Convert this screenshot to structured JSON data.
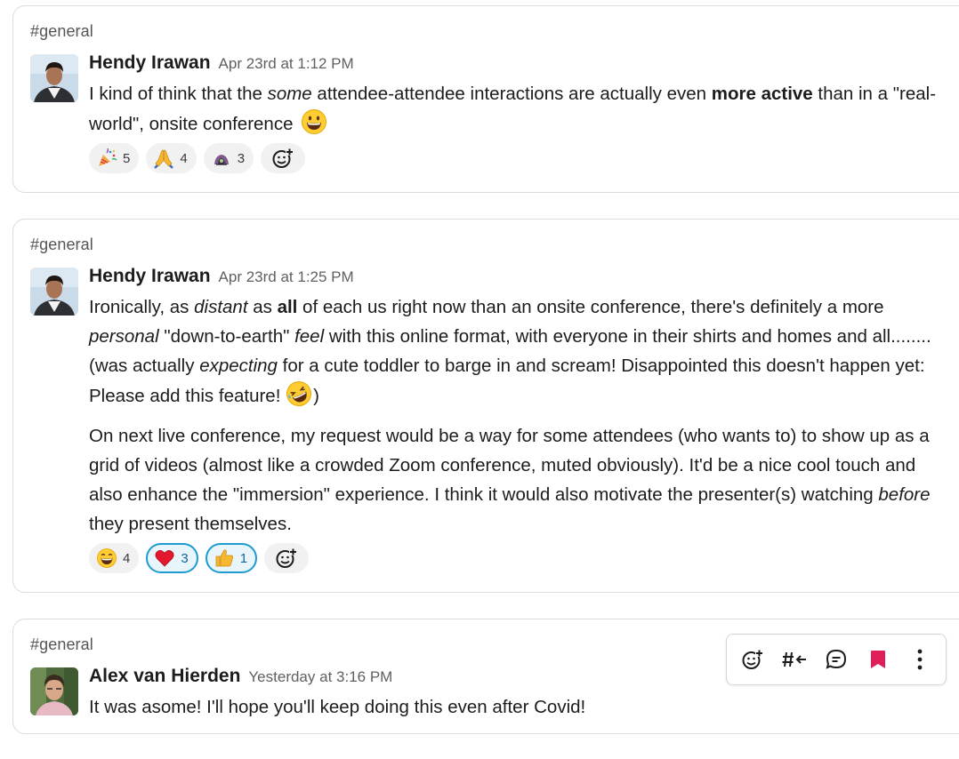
{
  "messages": [
    {
      "channel": "#general",
      "author": "Hendy Irawan",
      "timestamp": "Apr 23rd at 1:12 PM",
      "text": {
        "t1": "I kind of think that the ",
        "t1_em": "some",
        "t2": " attendee-attendee interactions are actually even ",
        "t2_bold": "more active",
        "t3": " than in a \"real-world\", onsite conference"
      },
      "inline_emoji": "grinning-face-icon",
      "reactions": [
        {
          "icon": "party-popper-icon",
          "count": "5",
          "mine": false
        },
        {
          "icon": "folded-hands-icon",
          "count": "4",
          "mine": false
        },
        {
          "icon": "custom-emoji-icon",
          "count": "3",
          "mine": false
        }
      ]
    },
    {
      "channel": "#general",
      "author": "Hendy Irawan",
      "timestamp": "Apr 23rd at 1:25 PM",
      "paragraph1": {
        "a": "Ironically, as ",
        "b_em": "distant",
        "c": " as ",
        "d_bold": "all",
        "e": " of each us right now than an onsite conference, there's definitely a more ",
        "f_em": "personal",
        "g": " \"down-to-earth\" ",
        "h_em": "feel",
        "i": " with this online format, with everyone in their shirts and homes and all........ (was actually ",
        "j_em": "expecting",
        "k": " for a cute toddler to barge in and scream! Disappointed this doesn't happen yet: Please add this feature! ",
        "l": ")"
      },
      "paragraph2": {
        "a": "On next live conference, my request would be a way for some attendees (who wants to) to show up as a grid of videos (almost like a crowded Zoom conference, muted obviously). It'd be a nice cool touch and also enhance the \"immersion\" experience. I think it would also motivate the presenter(s) watching ",
        "b_em": "before",
        "c": " they present themselves."
      },
      "inline_emoji": "rolling-on-floor-laughing-icon",
      "reactions": [
        {
          "icon": "grinning-squinting-face-icon",
          "count": "4",
          "mine": false
        },
        {
          "icon": "red-heart-icon",
          "count": "3",
          "mine": true
        },
        {
          "icon": "thumbs-up-icon",
          "count": "1",
          "mine": true
        }
      ]
    },
    {
      "channel": "#general",
      "author": "Alex van Hierden",
      "timestamp": "Yesterday at 3:16 PM",
      "text": "It was asome! I'll hope you'll keep doing this even after Covid!"
    }
  ],
  "hover_toolbar": {
    "actions": [
      "add-reaction-icon",
      "share-to-channel-icon",
      "reply-in-thread-icon",
      "saved-bookmark-icon",
      "more-actions-icon"
    ],
    "bookmark_color": "#e01e5a"
  },
  "colors": {
    "selected_reaction_border": "#1d9bd1",
    "selected_reaction_bg": "#e8f5fa",
    "card_border": "#dcdcdc"
  }
}
